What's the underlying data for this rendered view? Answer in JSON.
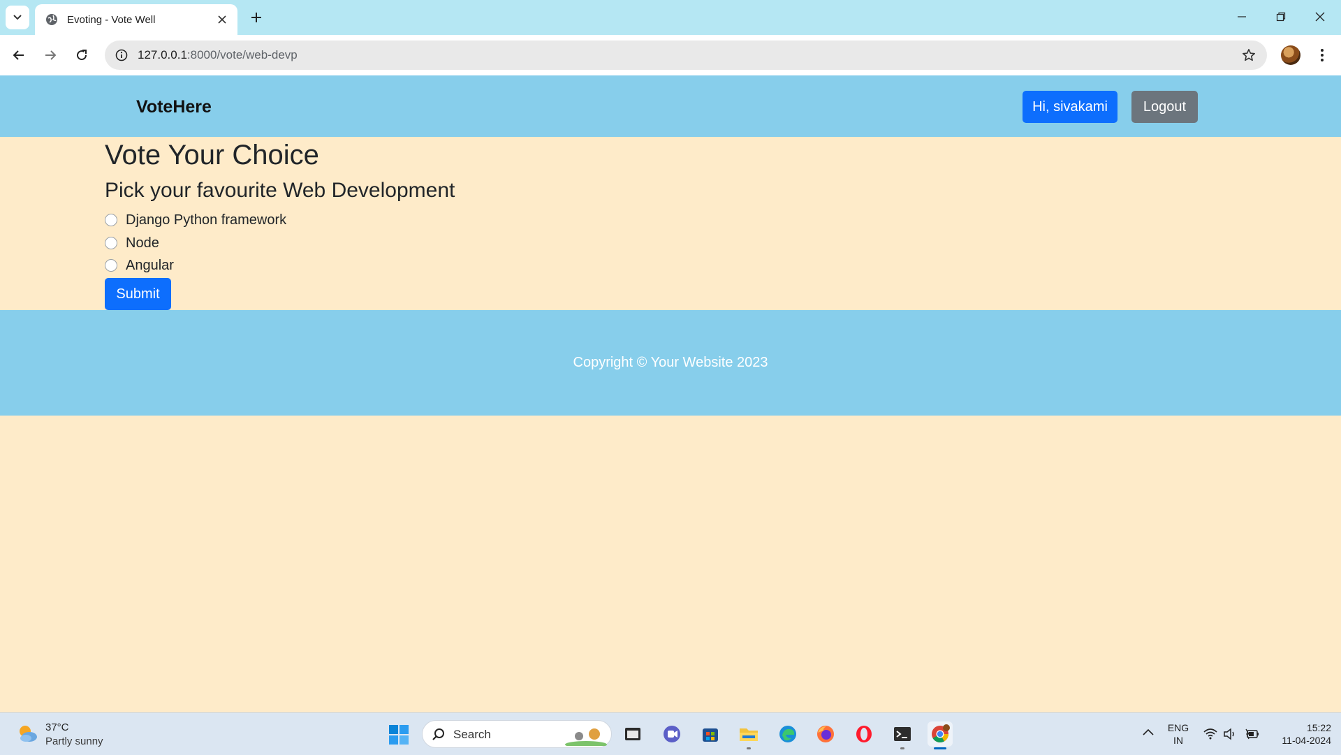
{
  "browser": {
    "tab_title": "Evoting - Vote Well",
    "url_host": "127.0.0.1",
    "url_rest": ":8000/vote/web-devp"
  },
  "navbar": {
    "brand": "VoteHere",
    "greeting": "Hi, sivakami",
    "logout": "Logout"
  },
  "main": {
    "title": "Vote Your Choice",
    "question": "Pick your favourite Web Development",
    "options": [
      "Django Python framework",
      "Node",
      "Angular"
    ],
    "submit": "Submit"
  },
  "footer": {
    "text": "Copyright © Your Website 2023"
  },
  "taskbar": {
    "weather_temp": "37°C",
    "weather_desc": "Partly sunny",
    "search_placeholder": "Search",
    "lang_line1": "ENG",
    "lang_line2": "IN",
    "time": "15:22",
    "date": "11-04-2024"
  },
  "colors": {
    "page_bg": "#feebc9",
    "nav_bg": "#87ceeb",
    "primary": "#0d6efd",
    "secondary": "#6c757d"
  },
  "icons": [
    "tab-search-icon",
    "globe-icon",
    "close-icon",
    "plus-icon",
    "minimize-icon",
    "restore-icon",
    "window-close-icon",
    "back-icon",
    "forward-icon",
    "reload-icon",
    "site-info-icon",
    "star-icon",
    "profile-avatar",
    "more-icon",
    "weather-icon",
    "windows-start-icon",
    "search-icon",
    "file-explorer-icon",
    "teams-icon",
    "store-icon",
    "folder-icon",
    "edge-icon",
    "firefox-icon",
    "opera-icon",
    "terminal-icon",
    "chrome-icon",
    "chevron-up-icon",
    "wifi-icon",
    "volume-icon",
    "battery-icon"
  ]
}
